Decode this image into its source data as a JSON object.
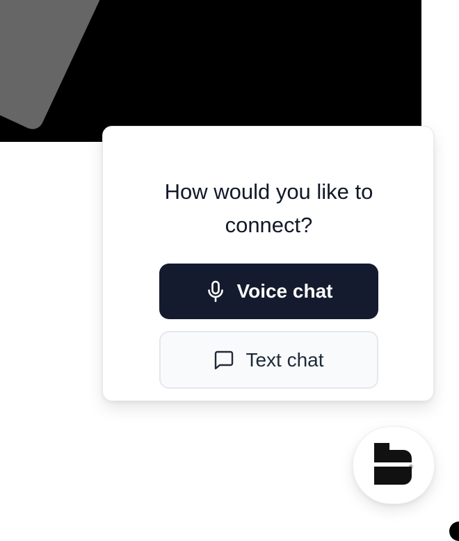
{
  "prompt": {
    "title": "How would you like to connect?"
  },
  "buttons": {
    "voice": {
      "label": "Voice chat",
      "icon": "microphone-icon"
    },
    "text": {
      "label": "Text chat",
      "icon": "chat-bubble-icon"
    }
  },
  "launcher": {
    "icon": "brand-logo-icon",
    "trademark": "®"
  },
  "colors": {
    "voice_button_bg": "#151b2e",
    "text_button_bg": "#f8fafc",
    "text_primary": "#111827",
    "hero_bg": "#000000"
  }
}
